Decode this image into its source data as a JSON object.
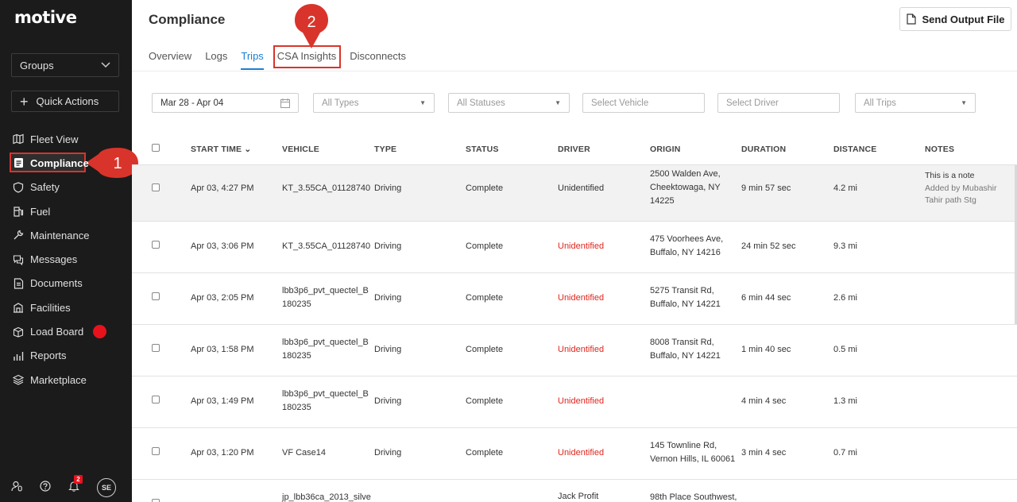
{
  "brand": "motive",
  "sidebar": {
    "groups_label": "Groups",
    "quick_actions_label": "Quick Actions",
    "items": [
      {
        "label": "Fleet View",
        "icon": "map-icon"
      },
      {
        "label": "Compliance",
        "icon": "document-icon"
      },
      {
        "label": "Safety",
        "icon": "shield-icon"
      },
      {
        "label": "Fuel",
        "icon": "fuel-icon"
      },
      {
        "label": "Maintenance",
        "icon": "wrench-icon"
      },
      {
        "label": "Messages",
        "icon": "chat-icon"
      },
      {
        "label": "Documents",
        "icon": "file-icon"
      },
      {
        "label": "Facilities",
        "icon": "building-icon"
      },
      {
        "label": "Load Board",
        "icon": "box-icon"
      },
      {
        "label": "Reports",
        "icon": "chart-icon"
      },
      {
        "label": "Marketplace",
        "icon": "layers-icon"
      }
    ],
    "notification_count": "2",
    "avatar_initials": "SE"
  },
  "callouts": {
    "one": "1",
    "two": "2"
  },
  "header": {
    "title": "Compliance",
    "send_button": "Send Output File",
    "tabs": [
      "Overview",
      "Logs",
      "Trips",
      "CSA Insights",
      "Disconnects"
    ],
    "active_tab": "Trips"
  },
  "filters": {
    "date": "Mar 28 - Apr 04",
    "types": "All Types",
    "statuses": "All Statuses",
    "vehicle": "Select Vehicle",
    "driver": "Select Driver",
    "trips": "All Trips"
  },
  "table": {
    "columns": [
      "START TIME",
      "VEHICLE",
      "TYPE",
      "STATUS",
      "DRIVER",
      "ORIGIN",
      "DURATION",
      "DISTANCE",
      "NOTES"
    ],
    "rows": [
      {
        "start": "Apr 03, 4:27 PM",
        "vehicle": "KT_3.55CA_01128740",
        "type": "Driving",
        "status": "Complete",
        "driver": "Unidentified",
        "origin": "2500 Walden Ave, Cheektowaga, NY 14225",
        "duration": "9 min 57 sec",
        "distance": "4.2 mi",
        "note": "This is a note",
        "note_by": "Added by Mubashir Tahir path Stg"
      },
      {
        "start": "Apr 03, 3:06 PM",
        "vehicle": "KT_3.55CA_01128740",
        "type": "Driving",
        "status": "Complete",
        "driver": "Unidentified",
        "origin": "475 Voorhees Ave, Buffalo, NY 14216",
        "duration": "24 min 52 sec",
        "distance": "9.3 mi",
        "note": "",
        "note_by": ""
      },
      {
        "start": "Apr 03, 2:05 PM",
        "vehicle": "lbb3p6_pvt_quectel_B 180235",
        "type": "Driving",
        "status": "Complete",
        "driver": "Unidentified",
        "origin": "5275 Transit Rd, Buffalo, NY 14221",
        "duration": "6 min 44 sec",
        "distance": "2.6 mi",
        "note": "",
        "note_by": ""
      },
      {
        "start": "Apr 03, 1:58 PM",
        "vehicle": "lbb3p6_pvt_quectel_B 180235",
        "type": "Driving",
        "status": "Complete",
        "driver": "Unidentified",
        "origin": "8008 Transit Rd, Buffalo, NY 14221",
        "duration": "1 min 40 sec",
        "distance": "0.5 mi",
        "note": "",
        "note_by": ""
      },
      {
        "start": "Apr 03, 1:49 PM",
        "vehicle": "lbb3p6_pvt_quectel_B 180235",
        "type": "Driving",
        "status": "Complete",
        "driver": "Unidentified",
        "origin": "",
        "duration": "4 min 4 sec",
        "distance": "1.3 mi",
        "note": "",
        "note_by": ""
      },
      {
        "start": "Apr 03, 1:20 PM",
        "vehicle": "VF Case14",
        "type": "Driving",
        "status": "Complete",
        "driver": "Unidentified",
        "origin": "145 Townline Rd, Vernon Hills, IL 60061",
        "duration": "3 min 4 sec",
        "distance": "0.7 mi",
        "note": "",
        "note_by": ""
      },
      {
        "start": "",
        "vehicle": "jp_lbb36ca_2013_silve",
        "type": "",
        "status": "",
        "driver": "Jack Profit",
        "origin": "98th Place Southwest,",
        "duration": "",
        "distance": "",
        "note": "",
        "note_by": ""
      }
    ]
  },
  "colors": {
    "accent": "#1a7fd6",
    "highlight": "#d9342b",
    "unidentified": "#e0261d",
    "sidebar": "#1b1b1b"
  }
}
